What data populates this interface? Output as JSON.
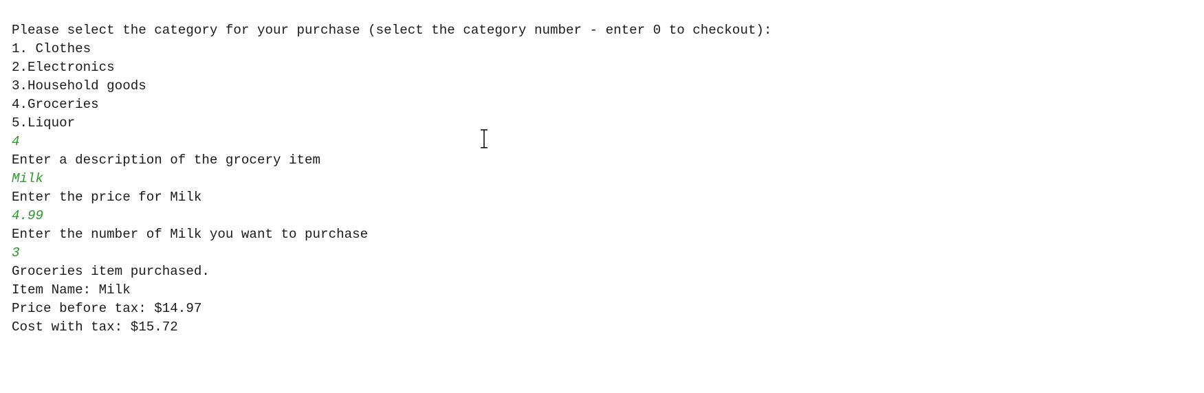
{
  "console": {
    "lines": [
      {
        "text": "Please select the category for your purchase (select the category number - enter 0 to checkout):",
        "type": "output"
      },
      {
        "text": "1. Clothes",
        "type": "output"
      },
      {
        "text": "2.Electronics",
        "type": "output"
      },
      {
        "text": "3.Household goods",
        "type": "output"
      },
      {
        "text": "4.Groceries",
        "type": "output"
      },
      {
        "text": "5.Liquor",
        "type": "output"
      },
      {
        "text": "4",
        "type": "input"
      },
      {
        "text": "Enter a description of the grocery item",
        "type": "output"
      },
      {
        "text": "Milk",
        "type": "input"
      },
      {
        "text": "Enter the price for Milk",
        "type": "output"
      },
      {
        "text": "4.99",
        "type": "input"
      },
      {
        "text": "Enter the number of Milk you want to purchase",
        "type": "output"
      },
      {
        "text": "3",
        "type": "input"
      },
      {
        "text": "Groceries item purchased.",
        "type": "output"
      },
      {
        "text": "Item Name: Milk",
        "type": "output"
      },
      {
        "text": "Price before tax: $14.97",
        "type": "output"
      },
      {
        "text": "Cost with tax: $15.72",
        "type": "output"
      }
    ]
  },
  "colors": {
    "output_text": "#1a1a1a",
    "input_text": "#2a9a2a",
    "background": "#ffffff"
  },
  "cursor": {
    "icon": "text-cursor-icon"
  }
}
